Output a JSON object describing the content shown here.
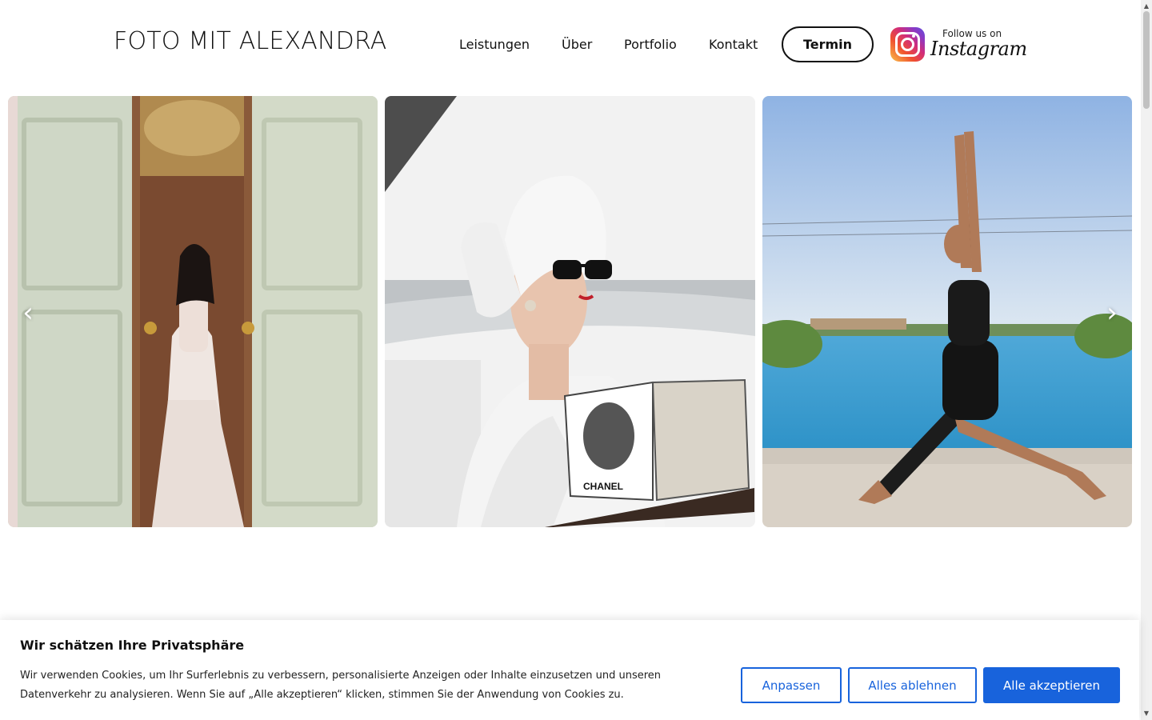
{
  "header": {
    "logo": "FOTO MIT ALEXANDRA",
    "nav": [
      "Leistungen",
      "Über",
      "Portfolio",
      "Kontakt"
    ],
    "cta_label": "Termin",
    "instagram": {
      "follow_text": "Follow us on",
      "wordmark": "Instagram",
      "icon": "instagram-icon"
    }
  },
  "gallery": {
    "images": [
      {
        "name": "bride-in-doorway",
        "alt": ""
      },
      {
        "name": "woman-with-towel-reading-magazine",
        "alt": "",
        "magazine_text": "CHANEL"
      },
      {
        "name": "yoga-pose-by-pool",
        "alt": ""
      }
    ],
    "prev_icon": "chevron-left-icon",
    "next_icon": "chevron-right-icon"
  },
  "cookie": {
    "title": "Wir schätzen Ihre Privatsphäre",
    "text": "Wir verwenden Cookies, um Ihr Surferlebnis zu verbessern, personalisierte Anzeigen oder Inhalte einzusetzen und unseren Datenverkehr zu analysieren. Wenn Sie auf „Alle akzeptieren“ klicken, stimmen Sie der Anwendung von Cookies zu.",
    "buttons": {
      "customize": "Anpassen",
      "reject": "Alles ablehnen",
      "accept": "Alle akzeptieren"
    }
  },
  "colors": {
    "accent": "#1863dc",
    "text": "#111111",
    "background": "#ffffff"
  }
}
